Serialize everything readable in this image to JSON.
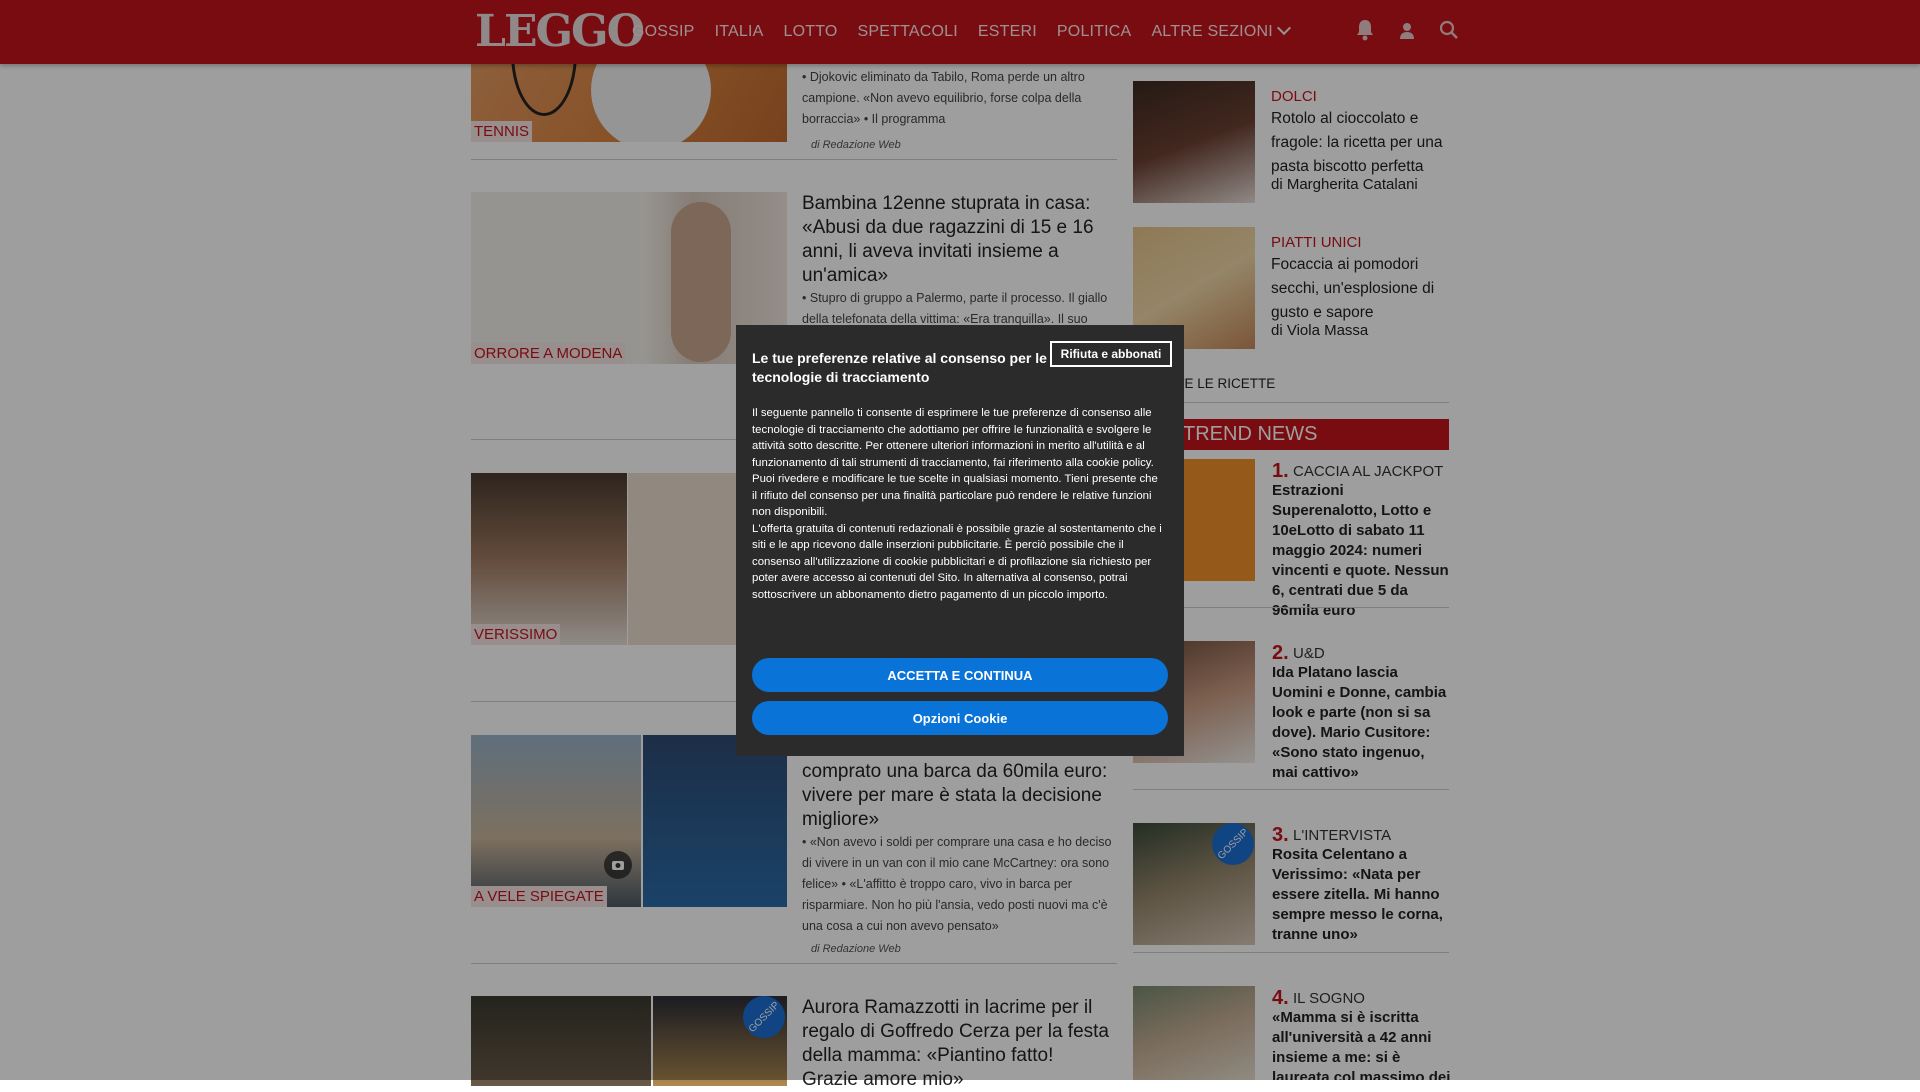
{
  "header": {
    "logo": "LEGGO",
    "nav": [
      "GOSSIP",
      "ITALIA",
      "LOTTO",
      "SPETTACOLI",
      "ESTERI",
      "POLITICA",
      "ALTRE SEZIONI"
    ],
    "icons": [
      "bell-icon",
      "user-icon",
      "search-icon"
    ]
  },
  "articles": [
    {
      "category": "TENNIS",
      "bullets": "Djokovic eliminato da Tabilo, Roma perde un altro campione. «Non avevo equilibrio, forse colpa della borraccia» • Il programma",
      "byline": "di Redazione Web"
    },
    {
      "category": "ORRORE A MODENA",
      "title": "Bambina 12enne stuprata in casa: «Abusi da due ragazzini di 15 e 16 anni, li aveva invitati insieme a un'amica»",
      "bullets": "Stupro di gruppo a Palermo, parte il processo. Il giallo della telefonata della vittima: «Era tranquilla». Il suo"
    },
    {
      "category": "VERISSIMO"
    },
    {
      "category": "A VELE SPIEGATE",
      "title": "comprato una barca da 60mila euro: vivere per mare è stata la decisione migliore»",
      "bullets": "«Non avevo i soldi per comprare una casa e ho deciso di vivere in un van con il mio cane McCartney: ora sono felice» • «L'affitto è troppo caro, vivo in barca per risparmiare. Non ho più l'ansia, vedo posti nuovi ma c'è una cosa a cui non avevo pensato»",
      "byline": "di Redazione Web"
    },
    {
      "category": "GOSSIP",
      "title": "Aurora Ramazzotti in lacrime per il regalo di Goffredo Cerza per la festa della mamma: «Piantino fatto! Grazie amore mio»"
    }
  ],
  "sidebar": {
    "recipes": [
      {
        "category": "DOLCI",
        "title": "Rotolo al cioccolato e fragole: la ricetta per una pasta biscotto perfetta",
        "author": "di Margherita Catalani"
      },
      {
        "category": "PIATTI UNICI",
        "title": "Focaccia ai pomodori secchi, un'esplosione di gusto e sapore",
        "author": "di Viola Massa"
      }
    ],
    "all_recipes": "TUTTE LE RICETTE",
    "trend_title": "TREND NEWS",
    "trend": [
      {
        "num": "1.",
        "category": "CACCIA AL JACKPOT",
        "title": "Estrazioni Superenalotto, Lotto e 10eLotto di sabato 11 maggio 2024: numeri vincenti e quote. Nessun 6, centrati due 5 da 96mila euro"
      },
      {
        "num": "2.",
        "category": "U&D",
        "title": "Ida Platano lascia Uomini e Donne, cambia look e parte (non si sa dove). Mario Cusitore: «Sono stato ingenuo, mai cattivo»"
      },
      {
        "num": "3.",
        "category": "L'INTERVISTA",
        "title": "Rosita Celentano a Verissimo: «Nata per essere zitella. Mi hanno sempre messo le corna, tranne uno»"
      },
      {
        "num": "4.",
        "category": "IL SOGNO",
        "title": "«Mamma si è iscritta all'università a 42 anni insieme a me: si è laureata col massimo dei"
      }
    ]
  },
  "consent": {
    "title": "Le tue preferenze relative al consenso per le tecnologie di tracciamento",
    "reject_label": "Rifiuta e abbonati",
    "body_1": "Il seguente pannello ti consente di esprimere le tue preferenze di consenso alle tecnologie di tracciamento che adottiamo per offrire le funzionalità e svolgere le attività sotto descritte. Per ottenere ulteriori informazioni in merito all'utilità e al funzionamento di tali strumenti di tracciamento, fai riferimento alla cookie policy. Puoi rivedere e modificare le tue scelte in qualsiasi momento. Tieni presente che il rifiuto del consenso per una finalità particolare può rendere le relative funzioni non disponibili.",
    "body_2": "L'offerta gratuita di contenuti redazionali è possibile grazie al sostentamento che i siti e le app ricevono dalle inserzioni pubblicitarie. È perciò possibile che il consenso all'utilizzazione di cookie pubblicitari e di profilazione sia richiesto per poter avere accesso ai contenuti del Sito. In alternativa al consenso, potrai sottoscrivere un abbonamento dietro pagamento di un piccolo importo.",
    "accept_label": "ACCETTA E CONTINUA",
    "options_label": "Opzioni Cookie"
  },
  "colors": {
    "brand": "#c4141c",
    "button": "#0a73d8",
    "modal": "#2b2b2b"
  }
}
